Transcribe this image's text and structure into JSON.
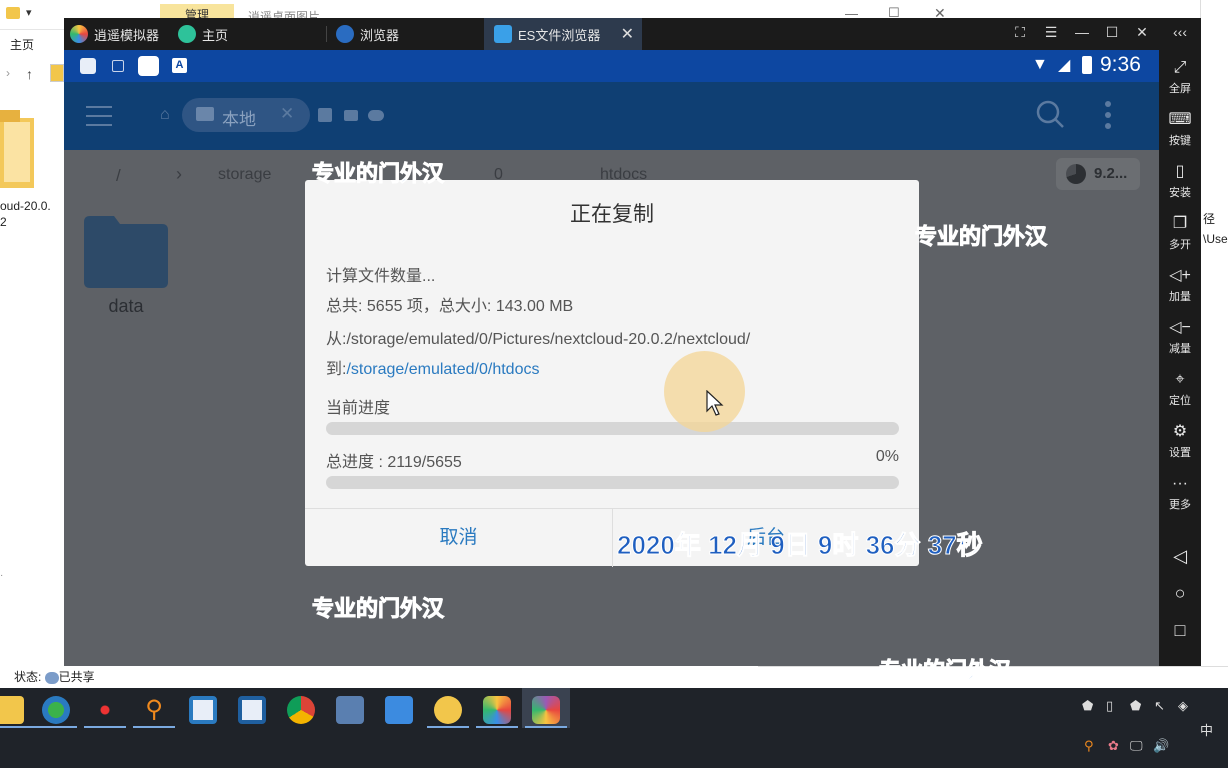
{
  "explorer": {
    "manage_tab": "管理",
    "title": "逍遥桌面图片",
    "ribbon_home": "主页",
    "folder_label_line1": "oud-20.0.",
    "folder_label_line2": "2",
    "status_text": "状态: ",
    "status_shared": "已共享",
    "right_text1": "径",
    "right_text2": "\\Use"
  },
  "emulator": {
    "tabs": [
      {
        "label": "逍遥模拟器"
      },
      {
        "label": "主页"
      },
      {
        "label": "浏览器"
      },
      {
        "label": "ES文件浏览器"
      }
    ],
    "status_time": "9:36",
    "appbar": {
      "location_chip": "本地"
    },
    "path": {
      "root": "/",
      "storage": "storage",
      "zero": "0",
      "htdocs": "htdocs",
      "storage_badge": "9.2..."
    },
    "folder": {
      "name": "data"
    },
    "side_panel": [
      {
        "label": "全屏",
        "icon": "fullscreen-icon"
      },
      {
        "label": "按键",
        "icon": "keyboard-icon"
      },
      {
        "label": "安装",
        "icon": "apk-icon"
      },
      {
        "label": "多开",
        "icon": "multi-instance-icon"
      },
      {
        "label": "加量",
        "icon": "volume-up-icon"
      },
      {
        "label": "减量",
        "icon": "volume-down-icon"
      },
      {
        "label": "定位",
        "icon": "location-icon"
      },
      {
        "label": "设置",
        "icon": "gear-icon"
      },
      {
        "label": "更多",
        "icon": "more-icon"
      }
    ]
  },
  "dialog": {
    "title": "正在复制",
    "calc_text": "计算文件数量...",
    "total_text": "总共: 5655 项，总大小: 143.00 MB",
    "from_text": "从:/storage/emulated/0/Pictures/nextcloud-20.0.2/nextcloud/",
    "to_prefix": "到:",
    "to_path": "/storage/emulated/0/htdocs",
    "current_progress_label": "当前进度",
    "current_progress": 0.0,
    "overall_label": "总进度 : 2119/5655",
    "overall_percent_text": "0%",
    "overall_progress": 0.0,
    "cancel_label": "取消",
    "background_label": "后台"
  },
  "watermarks": {
    "text": "专业的门外汉",
    "timestamp": "2020年 12月 9日 9时 36分 37秒"
  },
  "colors": {
    "accent": "#2a7ac0",
    "android_statusbar": "#0d47a1",
    "watermark": "#1f6fd4"
  }
}
